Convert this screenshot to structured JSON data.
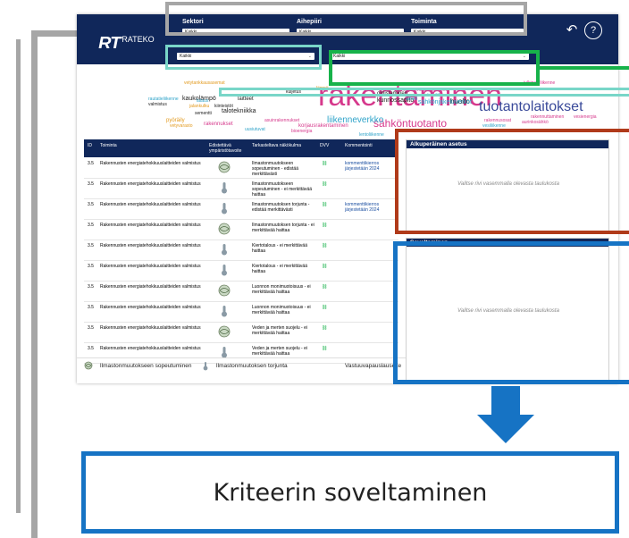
{
  "header": {
    "logo_mark": "RT",
    "logo_text": "RATEKO",
    "filters": [
      {
        "label": "Sektori",
        "value": "Kaikki"
      },
      {
        "label": "Aihepiiri",
        "value": "Kaikki"
      },
      {
        "label": "Toiminta",
        "value": "Kaikki"
      }
    ],
    "secondary_filters": [
      {
        "value": "Kaikki"
      },
      {
        "value": "Kaikki"
      }
    ]
  },
  "word_cloud": {
    "words": [
      {
        "text": "rakentaminen",
        "color": "#d6398c"
      },
      {
        "text": "tuotantolaitokset",
        "color": "#3a4a9a"
      },
      {
        "text": "sähköntuotanto",
        "color": "#d6398c"
      },
      {
        "text": "liikenneverkko",
        "color": "#2ea3c9"
      },
      {
        "text": "kunnossapito",
        "color": "#222222"
      },
      {
        "text": "huolto",
        "color": "#222222"
      },
      {
        "text": "omistaminen",
        "color": "#222222"
      },
      {
        "text": "kaukolämpö",
        "color": "#222222"
      },
      {
        "text": "talotekniikka",
        "color": "#222222"
      },
      {
        "text": "kiinteistöt",
        "color": "#222222"
      },
      {
        "text": "sementti",
        "color": "#222222"
      },
      {
        "text": "rautatieliikenne",
        "color": "#2ea3c9"
      },
      {
        "text": "asuinrakennukset",
        "color": "#d6398c"
      },
      {
        "text": "korjausrakentaminen",
        "color": "#d6398c"
      },
      {
        "text": "rakennukset",
        "color": "#d6398c"
      },
      {
        "text": "sähkönjakeluverkot",
        "color": "#2ea3c9"
      },
      {
        "text": "energiatehokkuuslaitteet",
        "color": "#d6398c"
      },
      {
        "text": "laitteet",
        "color": "#222222"
      },
      {
        "text": "pyöräily",
        "color": "#e29a1f"
      },
      {
        "text": "jalankulku",
        "color": "#e29a1f"
      },
      {
        "text": "julkinen liikenne",
        "color": "#d6398c"
      },
      {
        "text": "vetytankkausasemat",
        "color": "#e29a1f"
      },
      {
        "text": "uusiutuvat",
        "color": "#2ea3c9"
      },
      {
        "text": "sähkö",
        "color": "#2ea3c9"
      },
      {
        "text": "vesiliikenne",
        "color": "#2ea3c9"
      },
      {
        "text": "lentoliikenne",
        "color": "#2ea3c9"
      },
      {
        "text": "bioenergia",
        "color": "#d6398c"
      },
      {
        "text": "rakennusosat",
        "color": "#d6398c"
      },
      {
        "text": "aurinkosähkö",
        "color": "#d6398c"
      },
      {
        "text": "vetyvarasto",
        "color": "#e29a1f"
      },
      {
        "text": "lämpö",
        "color": "#e29a1f"
      },
      {
        "text": "lataus",
        "color": "#2ea3c9"
      },
      {
        "text": "tietoliikenne",
        "color": "#2ea3c9"
      },
      {
        "text": "rakennuttaminen",
        "color": "#d6398c"
      },
      {
        "text": "vesienergia",
        "color": "#d6398c"
      },
      {
        "text": "valmistus",
        "color": "#222222"
      },
      {
        "text": "kuljetus",
        "color": "#222222"
      }
    ]
  },
  "table": {
    "headers": [
      "ID",
      "Toiminta",
      "Edistettävä ympäristötavoite",
      "Tarkasteltava näkökulma",
      "DVV",
      "Kommentointi"
    ],
    "rows": [
      {
        "id": "3.5",
        "toiminta": "Rakennusten energiatehokkuuslaitteiden valmistus",
        "icon": "globe-icon",
        "nakokulma": "Ilmastonmuutokseen sopeutuminen - edistää merkittävästi",
        "comment": "kommenttikierros järjestetään 2024"
      },
      {
        "id": "3.5",
        "toiminta": "Rakennusten energiatehokkuuslaitteiden valmistus",
        "icon": "thermometer-icon",
        "nakokulma": "Ilmastonmuutokseen sopeutuminen - ei merkittävää haittaa",
        "comment": ""
      },
      {
        "id": "3.5",
        "toiminta": "Rakennusten energiatehokkuuslaitteiden valmistus",
        "icon": "thermometer-icon",
        "nakokulma": "Ilmastonmuutoksen torjunta - edistää merkittävästi",
        "comment": "kommenttikierros järjestetään 2024"
      },
      {
        "id": "3.5",
        "toiminta": "Rakennusten energiatehokkuuslaitteiden valmistus",
        "icon": "globe-icon",
        "nakokulma": "Ilmastonmuutoksen torjunta - ei merkittävää haittaa",
        "comment": ""
      },
      {
        "id": "3.5",
        "toiminta": "Rakennusten energiatehokkuuslaitteiden valmistus",
        "icon": "thermometer-icon",
        "nakokulma": "Kiertotalous - ei merkittävää haittaa",
        "comment": ""
      },
      {
        "id": "3.5",
        "toiminta": "Rakennusten energiatehokkuuslaitteiden valmistus",
        "icon": "thermometer-icon",
        "nakokulma": "Kiertotalous - ei merkittävää haittaa",
        "comment": ""
      },
      {
        "id": "3.5",
        "toiminta": "Rakennusten energiatehokkuuslaitteiden valmistus",
        "icon": "globe-icon",
        "nakokulma": "Luonnon monimuotoisuus - ei merkittävää haittaa",
        "comment": ""
      },
      {
        "id": "3.5",
        "toiminta": "Rakennusten energiatehokkuuslaitteiden valmistus",
        "icon": "thermometer-icon",
        "nakokulma": "Luonnon monimuotoisuus - ei merkittävää haittaa",
        "comment": ""
      },
      {
        "id": "3.5",
        "toiminta": "Rakennusten energiatehokkuuslaitteiden valmistus",
        "icon": "globe-icon",
        "nakokulma": "Veden ja merten suojelu - ei merkittävää haittaa",
        "comment": ""
      },
      {
        "id": "3.5",
        "toiminta": "Rakennusten energiatehokkuuslaitteiden valmistus",
        "icon": "thermometer-icon",
        "nakokulma": "Veden ja merten suojelu - ei merkittävää haittaa",
        "comment": ""
      }
    ]
  },
  "panels": {
    "original": {
      "title": "Alkuperäinen asetus",
      "placeholder": "Valitse rivi vasemmalla olevasta taulukosta"
    },
    "application": {
      "title": "Soveltaminen",
      "placeholder": "Valitse rivi vasemmalla olevasta taulukosta"
    }
  },
  "footer": {
    "legend_adapt": "Ilmastonmuutokseen sopeutuminen",
    "legend_mitigate": "Ilmastonmuutoksen torjunta",
    "disclaimer": "Vastuuvapauslauseke"
  },
  "callout": {
    "label": "Kriteerin soveltaminen"
  },
  "colors": {
    "navy": "#10275a",
    "callout_gray": "#a6a6a6",
    "callout_teal": "#79d6c8",
    "callout_green": "#17b24a",
    "callout_red": "#b03a1a",
    "callout_blue": "#1673c4"
  }
}
